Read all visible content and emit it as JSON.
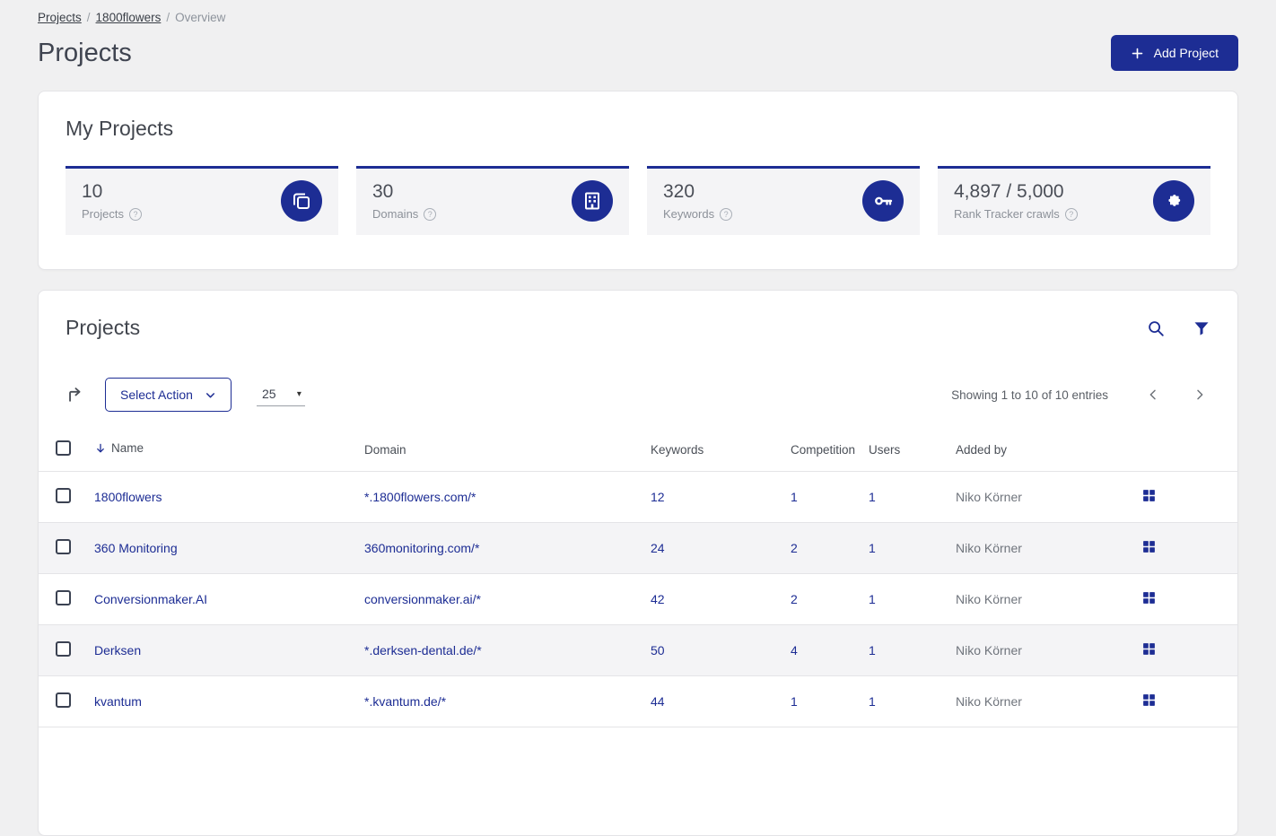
{
  "colors": {
    "primary": "#1d2d94"
  },
  "breadcrumb": {
    "items": [
      "Projects",
      "1800flowers",
      "Overview"
    ],
    "separator": "/"
  },
  "header": {
    "title": "Projects",
    "add_project_label": "Add Project"
  },
  "my_projects": {
    "title": "My Projects",
    "cards": [
      {
        "value": "10",
        "label": "Projects",
        "icon": "projects-icon"
      },
      {
        "value": "30",
        "label": "Domains",
        "icon": "domains-icon"
      },
      {
        "value": "320",
        "label": "Keywords",
        "icon": "keywords-icon"
      },
      {
        "value": "4,897 / 5,000",
        "label": "Rank Tracker crawls",
        "icon": "rank-tracker-icon"
      }
    ]
  },
  "projects_table": {
    "title": "Projects",
    "toolbar": {
      "select_action_label": "Select Action",
      "page_size": "25",
      "showing_text": "Showing 1 to 10 of 10 entries"
    },
    "columns": {
      "name": "Name",
      "domain": "Domain",
      "keywords": "Keywords",
      "competition": "Competition",
      "users": "Users",
      "added_by": "Added by"
    },
    "rows": [
      {
        "name": "1800flowers",
        "domain": "*.1800flowers.com/*",
        "keywords": "12",
        "competition": "1",
        "users": "1",
        "added_by": "Niko Körner"
      },
      {
        "name": "360 Monitoring",
        "domain": "360monitoring.com/*",
        "keywords": "24",
        "competition": "2",
        "users": "1",
        "added_by": "Niko Körner"
      },
      {
        "name": "Conversionmaker.AI",
        "domain": "conversionmaker.ai/*",
        "keywords": "42",
        "competition": "2",
        "users": "1",
        "added_by": "Niko Körner"
      },
      {
        "name": "Derksen",
        "domain": "*.derksen-dental.de/*",
        "keywords": "50",
        "competition": "4",
        "users": "1",
        "added_by": "Niko Körner"
      },
      {
        "name": "kvantum",
        "domain": "*.kvantum.de/*",
        "keywords": "44",
        "competition": "1",
        "users": "1",
        "added_by": "Niko Körner"
      }
    ]
  }
}
